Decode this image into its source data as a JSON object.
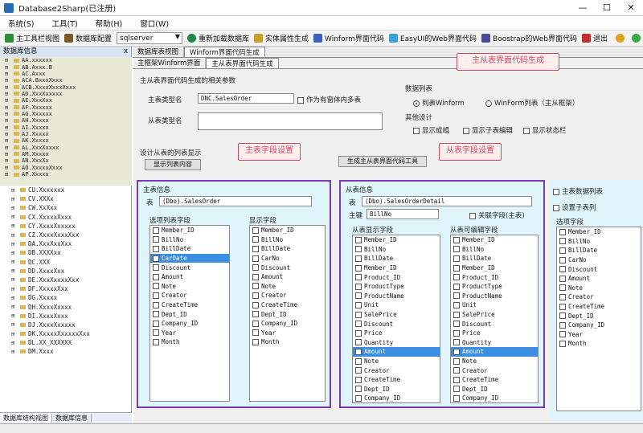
{
  "window": {
    "title": "Database2Sharp(已注册)"
  },
  "menu": [
    "系统(S)",
    "工具(T)",
    "帮助(H)",
    "窗口(W)"
  ],
  "toolbar": {
    "items": [
      {
        "label": "主工具栏视图",
        "color": "#2e8b3a"
      },
      {
        "label": "数据库配置",
        "color": "#7a5a2a"
      }
    ],
    "db_value": "sqlserver",
    "items2": [
      {
        "label": "重新加载数据库",
        "color": "#1e8a4a"
      },
      {
        "label": "实体属性生成",
        "color": "#c8a030"
      },
      {
        "label": "Winform界面代码",
        "color": "#3a5fbf"
      },
      {
        "label": "EasyUI的Web界面代码",
        "color": "#3aa0d8"
      },
      {
        "label": "Boostrap的Web界面代码",
        "color": "#4a4aa0"
      },
      {
        "label": "退出",
        "color": "#c03030"
      }
    ]
  },
  "leftpanel": {
    "header": "数据库信息",
    "close": "x",
    "tree_upper": [
      "AA.xxxxxx",
      "AB.Axxx.B",
      "AC.Axxx",
      "ACA.BxxxXxxx",
      "ACB.XxxxXxxxXxxx",
      "AD.XxxXxxxxx",
      "AE.XxxXxx",
      "AF.Xxxxxx",
      "AG.Xxxxxx",
      "AH.Xxxxx",
      "AI.Xxxxx",
      "AJ.Xxxxx",
      "AK.Xxxxx",
      "AL.XxxXxxxx",
      "AM.Xxxxx",
      "AN.XxxXx",
      "AO.XxxxxXxxx",
      "AP.Xxxxx"
    ],
    "tree_lower": [
      "CU.Xxxxxxx",
      "CV.XXXx",
      "CW.XxXxx",
      "CX.XxxxxXxxx",
      "CY.XxxxXxxxxx",
      "CZ.XxxxXxxxXxx",
      "DA.XxxXxxXxx",
      "DB.XXXXxx",
      "DC.XXX",
      "DD.XxxxXxx",
      "DE.XxxXxxxxXxx",
      "DF.XxxxxXxx",
      "DG.Xxxxx",
      "DH.XxxxXxxxx",
      "DI.XxxxXxxx",
      "DJ.XxxxXxxxxx",
      "DK.XxxxxXxxxxxXxx",
      "DL.XX_XXXXXX",
      "DM.Xxxx"
    ],
    "tab_a": "数据库结构视图",
    "tab_b": "数据库信息"
  },
  "tabs1": [
    "数据库表视图",
    "Winform界面代码生成"
  ],
  "tabs2": [
    "主框架Winform界面",
    "主从表界面代码生成"
  ],
  "main": {
    "group_title": "主从表界面代码生成的相关参数",
    "main_table_label": "主表类型名",
    "main_table_value": "DNC.SalesOrder",
    "sub_table_label": "从表类型名",
    "chk_child": "作为有窗体内多表",
    "display_group": "数据列表",
    "radio_winform": "列表Winform",
    "radio_web": "WinForm列表（主从框架）",
    "options_group": "其他设计",
    "opt1": "显示成组",
    "opt2": "显示子表编辑",
    "opt3": "显示状态栏",
    "sub_list_label": "设计从表的列表显示",
    "sub_list_label2": "对话框界面类型",
    "sub_list_btn": "显示列表内容",
    "gen_btn": "生成主从表界面代码工具",
    "callout1": "主从表界面代码生成",
    "callout2": "主表字段设置",
    "callout3": "从表字段设置",
    "left_panel": {
      "title": "主表信息",
      "combo_label": "表",
      "combo_value": "(Dbo).SalesOrder",
      "list_header_a": "选项列表字段",
      "list_header_b": "显示字段",
      "fields_a": [
        "Member_ID",
        "BillNo",
        "BillDate",
        "CarDate",
        "Discount",
        "Amount",
        "Note",
        "Creator",
        "CreateTime",
        "Dept_ID",
        "Company_ID",
        "Year",
        "Month"
      ],
      "fields_b": [
        "Member_ID",
        "BillNo",
        "BillDate",
        "CarNo",
        "Discount",
        "Amount",
        "Note",
        "Creator",
        "CreateTime",
        "Dept_ID",
        "Company_ID",
        "Year",
        "Month"
      ],
      "selected_index": 3
    },
    "right_panel": {
      "title": "从表信息",
      "combo_label": "表",
      "combo_value": "(Dbo).SalesOrderDetail",
      "key_label": "主键",
      "key_value": "BillNo",
      "link_label": "关联字段(主表)",
      "list_header_a": "从表显示字段",
      "list_header_b": "从表可编辑字段",
      "fields_a": [
        "Member_ID",
        "BillNo",
        "BillDate",
        "Member_ID",
        "Product_ID",
        "ProductType",
        "ProductName",
        "Unit",
        "SalePrice",
        "Discount",
        "Price",
        "Quantity",
        "Amount",
        "Note",
        "Creator",
        "CreateTime",
        "Dept_ID",
        "Company_ID"
      ],
      "fields_b": [
        "Member_ID",
        "BillNo",
        "BillDate",
        "Member_ID",
        "Product_ID",
        "ProductType",
        "ProductName",
        "Unit",
        "SalePrice",
        "Discount",
        "Price",
        "Quantity",
        "Amount",
        "Note",
        "Creator",
        "CreateTime",
        "Dept_ID",
        "Company_ID"
      ],
      "selected_index": 12
    },
    "far_right": {
      "chk1": "主表数据列表",
      "chk2": "设置子表列",
      "list_label": "选项字段",
      "fields": [
        "Member_ID",
        "BillNo",
        "BillDate",
        "CarNo",
        "Discount",
        "Amount",
        "Note",
        "Creator",
        "CreateTime",
        "Dept_ID",
        "Company_ID",
        "Year",
        "Month"
      ]
    }
  }
}
